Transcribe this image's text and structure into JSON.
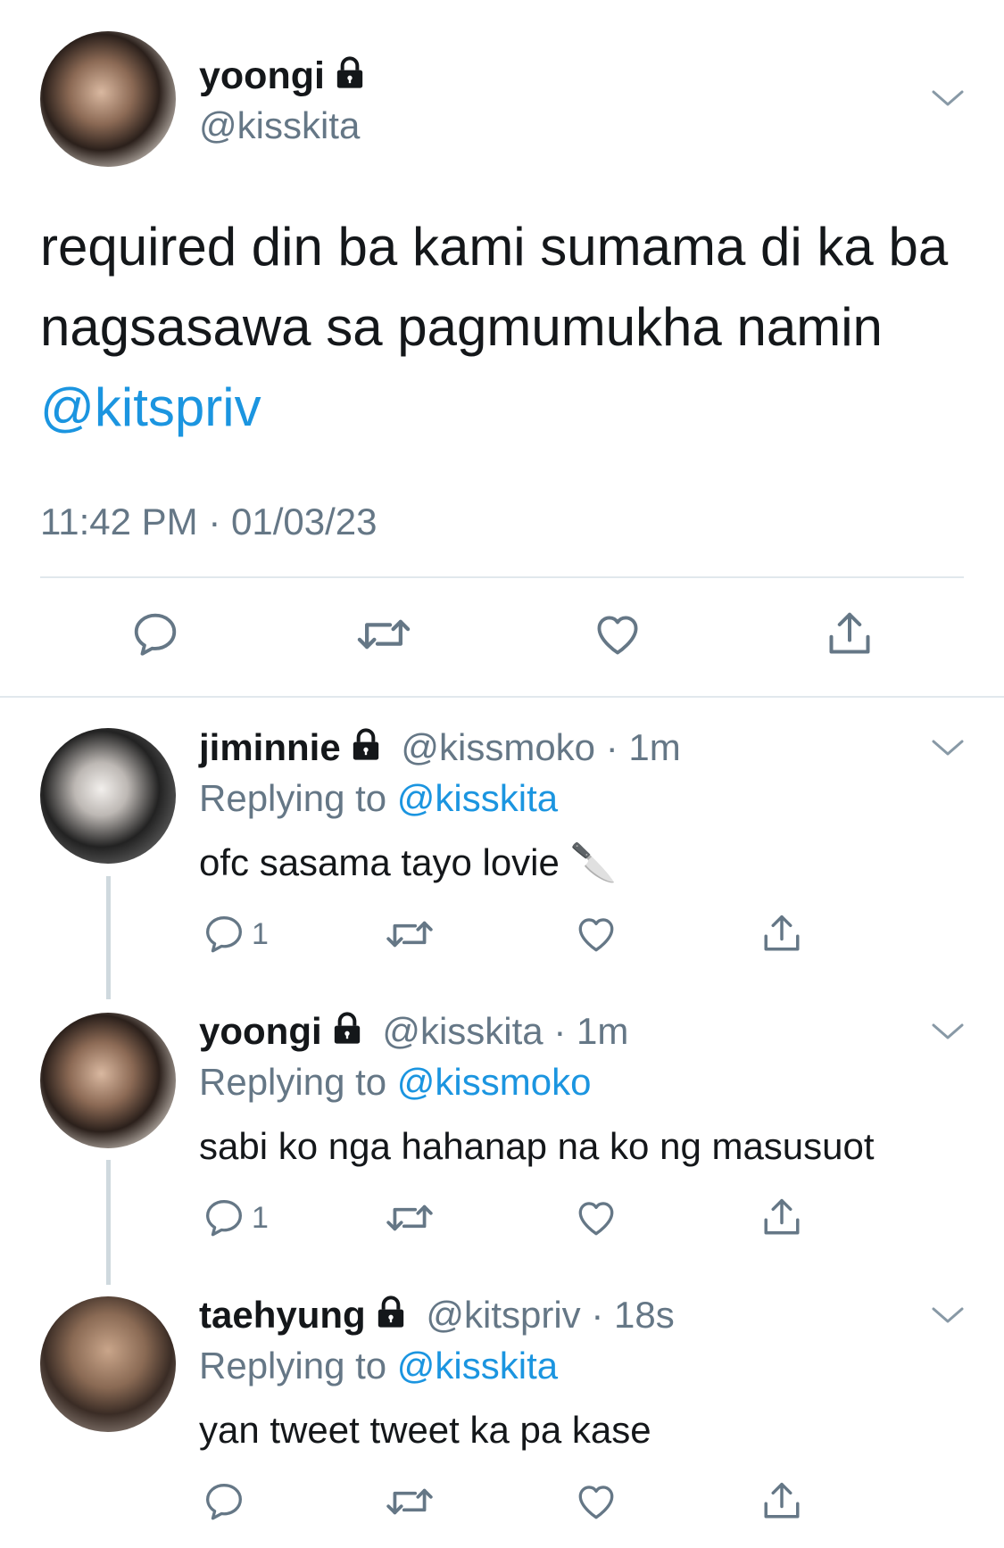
{
  "main_tweet": {
    "author_name": "yoongi",
    "author_handle": "@kisskita",
    "text_line1": "required din ba kami sumama di ka ba",
    "text_line2": "nagsasawa sa pagmumukha namin",
    "mention": "@kitspriv",
    "timestamp": "11:42 PM · 01/03/23"
  },
  "replies": [
    {
      "name": "jiminnie",
      "handle": "@kissmoko",
      "time": "· 1m",
      "replying_label": "Replying to",
      "replying_to": "@kisskita",
      "text": "ofc sasama tayo lovie",
      "emoji": "🔪",
      "reply_count": "1"
    },
    {
      "name": "yoongi",
      "handle": "@kisskita",
      "time": "· 1m",
      "replying_label": "Replying to",
      "replying_to": "@kissmoko",
      "text": "sabi ko nga hahanap na ko ng masusuot",
      "reply_count": "1"
    },
    {
      "name": "taehyung",
      "handle": "@kitspriv",
      "time": "· 18s",
      "replying_label": "Replying to",
      "replying_to": "@kisskita",
      "text": "yan tweet tweet ka pa kase",
      "reply_count": ""
    }
  ],
  "colors": {
    "link": "#1b95e0",
    "secondary": "#657786",
    "divider": "#e1e8ed"
  }
}
